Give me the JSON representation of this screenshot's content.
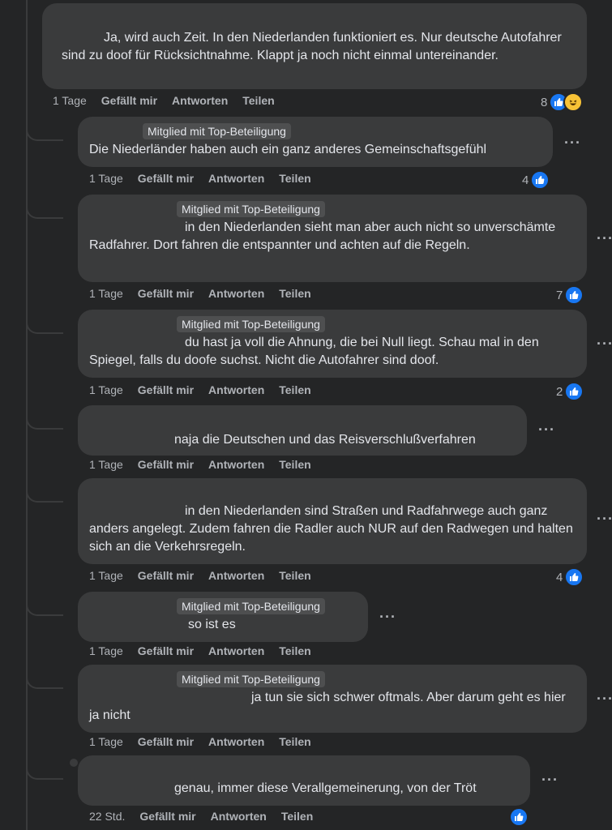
{
  "actions": {
    "like_label": "Gefällt mir",
    "reply_label": "Antworten",
    "share_label": "Teilen"
  },
  "comments": [
    {
      "time": "1 Tage",
      "badge": "",
      "text": "Ja, wird auch Zeit. In den Niederlanden funktioniert es. Nur deutsche Autofahrer sind zu doof für Rücksichtnahme. Klappt ja noch nicht einmal untereinander.",
      "reaction_count": "8"
    },
    {
      "time": "1 Tage",
      "badge": "Mitglied mit Top-Beteiligung",
      "text": "Die Niederländer haben auch ein ganz anderes Gemeinschaftsgefühl",
      "reaction_count": "4"
    },
    {
      "time": "1 Tage",
      "badge": "Mitglied mit Top-Beteiligung",
      "text": "in den Niederlanden sieht man aber auch nicht so unverschämte Radfahrer. Dort fahren die entspannter und achten auf die Regeln.",
      "reaction_count": "7"
    },
    {
      "time": "1 Tage",
      "badge": "Mitglied mit Top-Beteiligung",
      "text": "du hast ja voll die Ahnung, die bei Null liegt. Schau mal in den Spiegel, falls du doofe suchst. Nicht die Autofahrer sind doof.",
      "reaction_count": "2"
    },
    {
      "time": "1 Tage",
      "badge": "",
      "text": "naja die Deutschen und das Reisverschlußverfahren",
      "reaction_count": ""
    },
    {
      "time": "1 Tage",
      "badge": "",
      "text": "in den Niederlanden sind Straßen und Radfahrwege auch ganz anders angelegt. Zudem fahren die Radler auch NUR auf den Radwegen und halten sich an die Verkehrsregeln.",
      "reaction_count": "4"
    },
    {
      "time": "1 Tage",
      "badge": "Mitglied mit Top-Beteiligung",
      "text": "so ist es",
      "reaction_count": ""
    },
    {
      "time": "1 Tage",
      "badge": "Mitglied mit Top-Beteiligung",
      "text": "ja tun sie sich schwer oftmals. Aber darum geht es hier ja nicht",
      "reaction_count": ""
    },
    {
      "time": "22 Std.",
      "badge": "",
      "text": "genau, immer diese Verallgemeinerung, von der Tröt",
      "reaction_count": ""
    }
  ],
  "colors": {
    "background": "#242526",
    "bubble": "#3a3b3c",
    "like_blue": "#1877f2",
    "secondary_text": "#b0b3b8"
  },
  "icons": [
    "like-icon",
    "haha-icon",
    "more-options-icon"
  ]
}
